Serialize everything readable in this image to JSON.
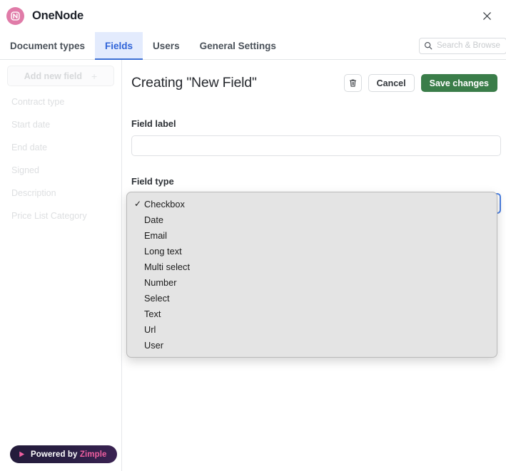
{
  "app": {
    "brand_name": "OneNode",
    "logo_icon": "onenode-logo-icon",
    "close_icon": "close-icon"
  },
  "tabs": [
    {
      "label": "Document types",
      "active": false
    },
    {
      "label": "Fields",
      "active": true
    },
    {
      "label": "Users",
      "active": false
    },
    {
      "label": "General Settings",
      "active": false
    }
  ],
  "search": {
    "icon": "search-icon",
    "placeholder": "Search & Browse",
    "value": ""
  },
  "sidebar": {
    "add_button": {
      "label": "Add new field",
      "plus": "+"
    },
    "items": [
      {
        "label": "Contract type"
      },
      {
        "label": "Start date"
      },
      {
        "label": "End date"
      },
      {
        "label": "Signed"
      },
      {
        "label": "Description"
      },
      {
        "label": "Price List Category"
      }
    ],
    "footer_badge": {
      "prefix": "Powered by",
      "brand": "Zimple",
      "icon": "play-triangle-icon"
    }
  },
  "main": {
    "title": "Creating \"New Field\"",
    "actions": {
      "delete_icon": "trash-icon",
      "cancel_label": "Cancel",
      "save_label": "Save changes"
    },
    "form": {
      "field_label_label": "Field label",
      "field_label_value": "",
      "field_label_placeholder": "",
      "field_type_label": "Field type",
      "field_type_value": "Checkbox"
    }
  },
  "dropdown": {
    "open": true,
    "selected": "Checkbox",
    "check_glyph": "✓",
    "options": [
      {
        "label": "Checkbox",
        "selected": true
      },
      {
        "label": "Date",
        "selected": false
      },
      {
        "label": "Email",
        "selected": false
      },
      {
        "label": "Long text",
        "selected": false
      },
      {
        "label": "Multi select",
        "selected": false
      },
      {
        "label": "Number",
        "selected": false
      },
      {
        "label": "Select",
        "selected": false
      },
      {
        "label": "Text",
        "selected": false
      },
      {
        "label": "Url",
        "selected": false
      },
      {
        "label": "User",
        "selected": false
      }
    ]
  },
  "colors": {
    "brand_pink": "#e07ba8",
    "tab_active_bg": "#e3ebfd",
    "tab_active_text": "#2f63d8",
    "save_green": "#3a7d49",
    "badge_pink": "#ef5fa0",
    "focus_blue": "#4b7fe0"
  }
}
